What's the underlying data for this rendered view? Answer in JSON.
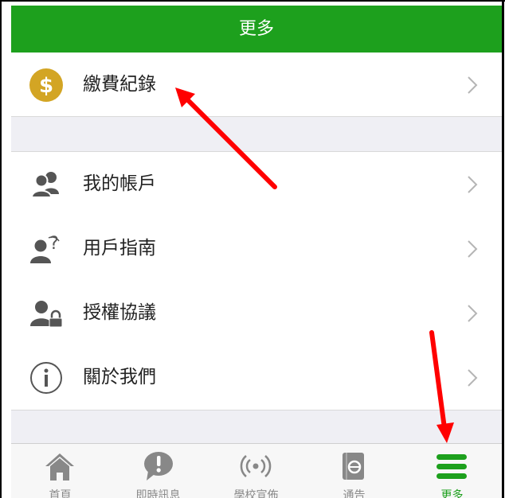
{
  "header": {
    "title": "更多"
  },
  "menu": {
    "payment": {
      "label": "繳費紀錄",
      "icon": "dollar-coin-icon"
    },
    "items": [
      {
        "label": "我的帳戶",
        "icon": "users-icon"
      },
      {
        "label": "用戶指南",
        "icon": "user-help-icon"
      },
      {
        "label": "授權協議",
        "icon": "user-lock-icon"
      },
      {
        "label": "關於我們",
        "icon": "info-circle-icon"
      }
    ]
  },
  "tabbar": {
    "tabs": [
      {
        "label": "首頁",
        "icon": "home-icon"
      },
      {
        "label": "即時訊息",
        "icon": "alert-bubble-icon"
      },
      {
        "label": "學校宣佈",
        "icon": "broadcast-icon"
      },
      {
        "label": "通告",
        "icon": "notice-book-icon"
      },
      {
        "label": "更多",
        "icon": "menu-bars-icon",
        "active": true
      }
    ]
  },
  "colors": {
    "brand_green": "#1da01d",
    "coin_gold": "#d3a524",
    "icon_gray": "#555555",
    "annotation_red": "#ff0000"
  }
}
